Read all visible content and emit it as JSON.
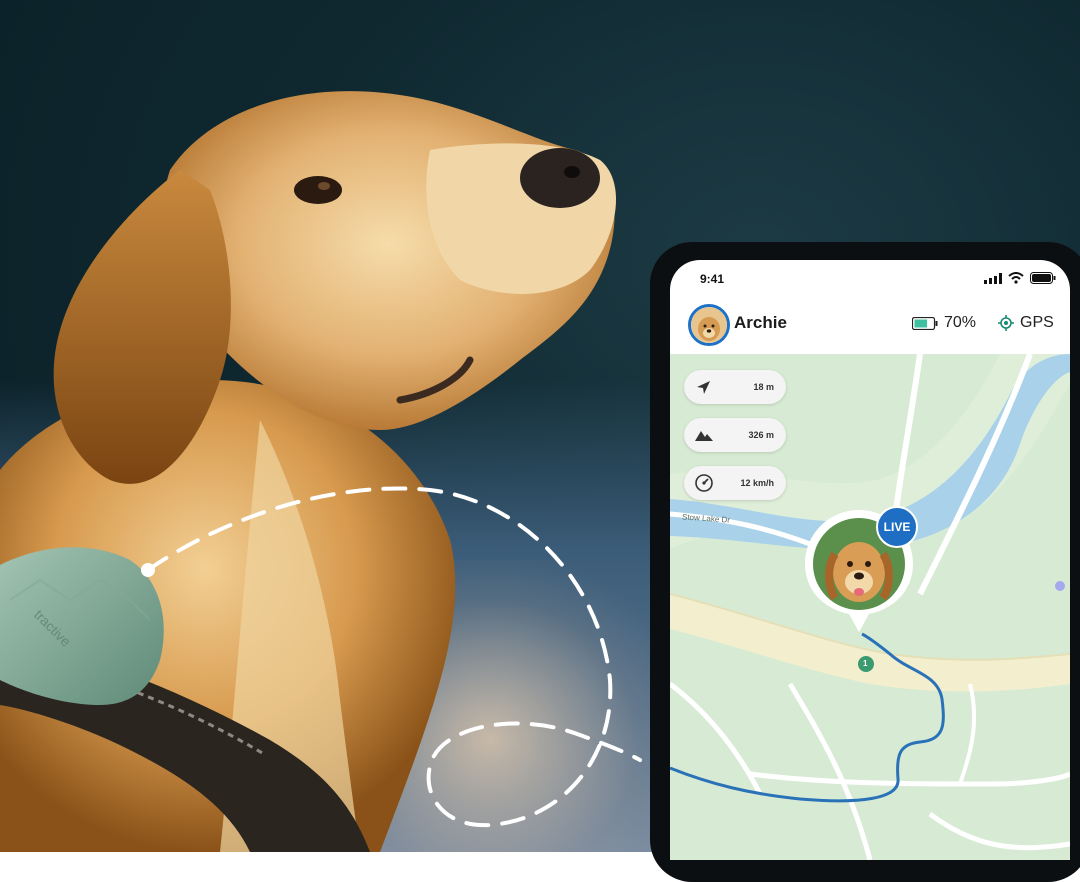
{
  "phone": {
    "status_time": "9:41",
    "pet_name": "Archie",
    "battery_percent": "70%",
    "battery_level": 0.7,
    "gps_label": "GPS",
    "live_badge": "LIVE",
    "stats": [
      {
        "icon": "navigation-arrow-icon",
        "value": "18 m"
      },
      {
        "icon": "mountain-icon",
        "value": "326 m"
      },
      {
        "icon": "speedometer-icon",
        "value": "12 km/h"
      }
    ],
    "map": {
      "road_label": "Stow Lake Dr",
      "waypoint_label": "1"
    }
  },
  "collar": {
    "brand": "tractive"
  },
  "colors": {
    "accent": "#1e6fc4",
    "map_green": "#d3e9d0",
    "water": "#a7cfe9",
    "route": "#2a72b8",
    "battery": "#3fc0a0"
  }
}
